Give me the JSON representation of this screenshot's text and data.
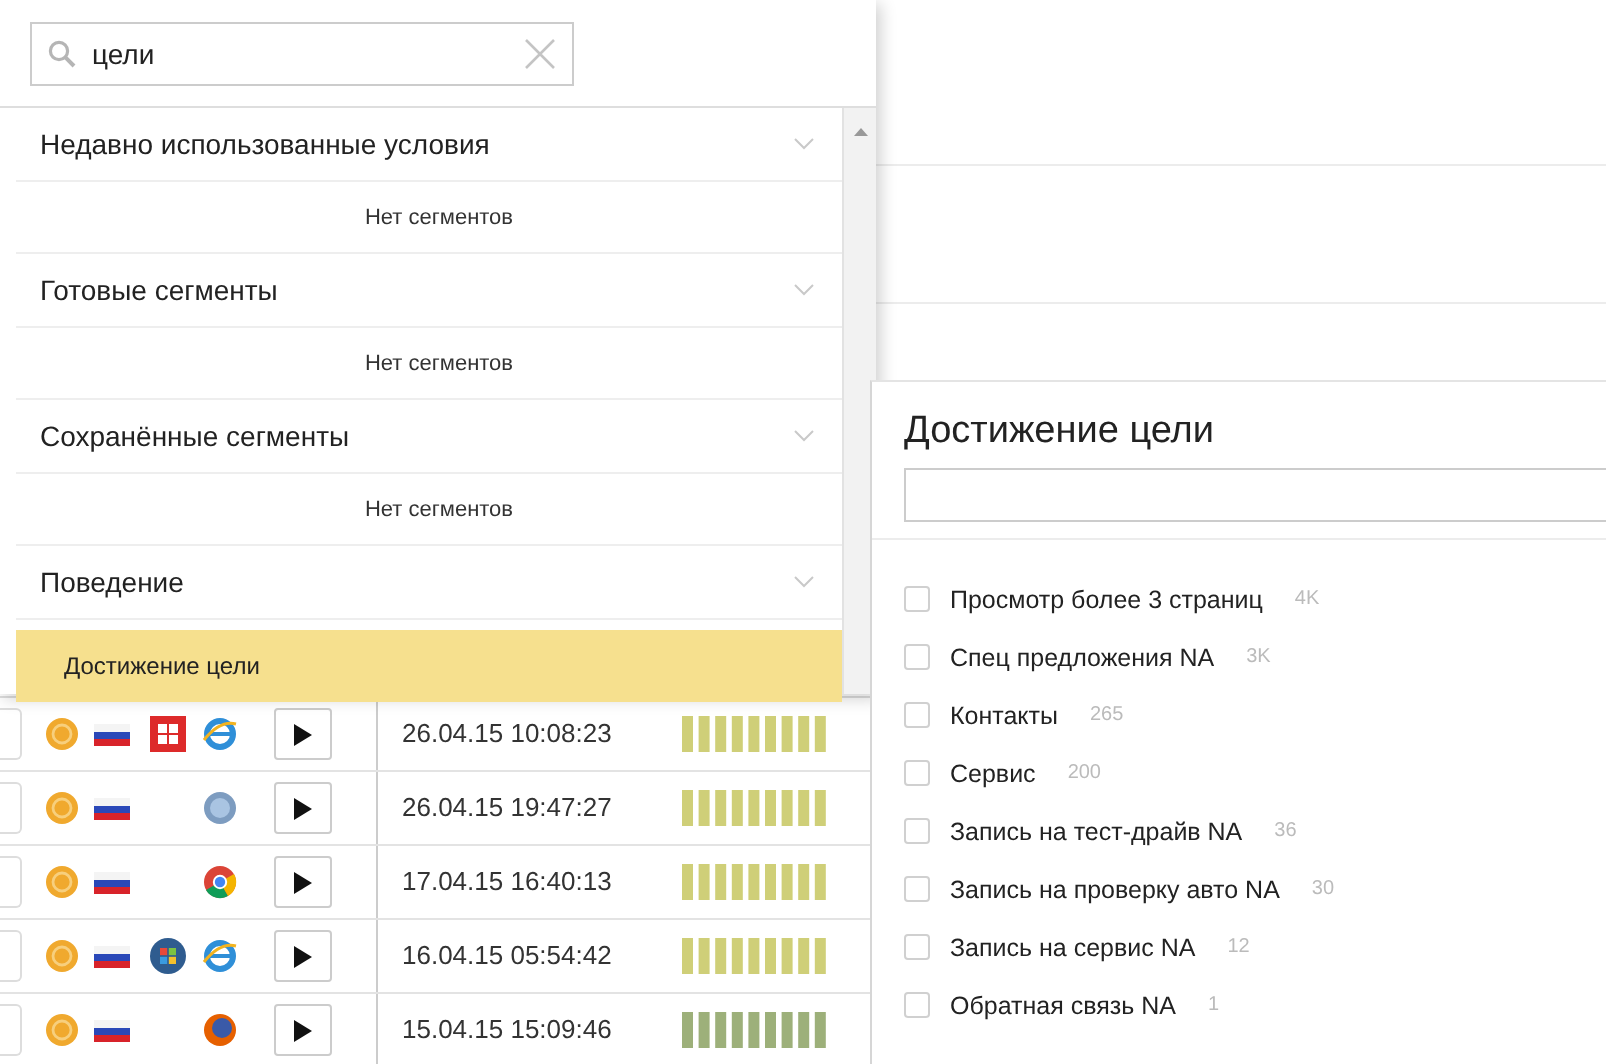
{
  "search": {
    "value": "цели"
  },
  "sections": [
    {
      "title": "Недавно использованные условия",
      "expanded": true,
      "empty_text": "Нет сегментов"
    },
    {
      "title": "Готовые сегменты",
      "expanded": true,
      "empty_text": "Нет сегментов"
    },
    {
      "title": "Сохранённые сегменты",
      "expanded": true,
      "empty_text": "Нет сегментов"
    },
    {
      "title": "Поведение",
      "expanded": true,
      "items": [
        {
          "label": "Достижение цели",
          "selected": true
        }
      ]
    }
  ],
  "visits": [
    {
      "os": {
        "kind": "windows8"
      },
      "browser": {
        "kind": "ie"
      },
      "time": "26.04.15 10:08:23",
      "color": "#cfcf78"
    },
    {
      "os": {
        "kind": "blank"
      },
      "browser": {
        "kind": "safari"
      },
      "time": "26.04.15 19:47:27",
      "color": "#cfcf78"
    },
    {
      "os": {
        "kind": "blank"
      },
      "browser": {
        "kind": "chrome"
      },
      "time": "17.04.15 16:40:13",
      "color": "#cfcf78"
    },
    {
      "os": {
        "kind": "windows7"
      },
      "browser": {
        "kind": "ie"
      },
      "time": "16.04.15 05:54:42",
      "color": "#cfcf78"
    },
    {
      "os": {
        "kind": "blank"
      },
      "browser": {
        "kind": "firefox"
      },
      "time": "15.04.15 15:09:46",
      "color": "#9db07a"
    }
  ],
  "goal_panel": {
    "title": "Достижение цели",
    "goals": [
      {
        "label": "Просмотр более 3 страниц",
        "count": "4K",
        "checked": false
      },
      {
        "label": "Спец предложения NA",
        "count": "3K",
        "checked": false
      },
      {
        "label": "Контакты",
        "count": "265",
        "checked": false
      },
      {
        "label": "Сервис",
        "count": "200",
        "checked": false
      },
      {
        "label": "Запись на тест-драйв NA",
        "count": "36",
        "checked": false
      },
      {
        "label": "Запись на проверку авто NA",
        "count": "30",
        "checked": false
      },
      {
        "label": "Запись на сервис NA",
        "count": "12",
        "checked": false
      },
      {
        "label": "Обратная связь NA",
        "count": "1",
        "checked": false
      }
    ]
  }
}
